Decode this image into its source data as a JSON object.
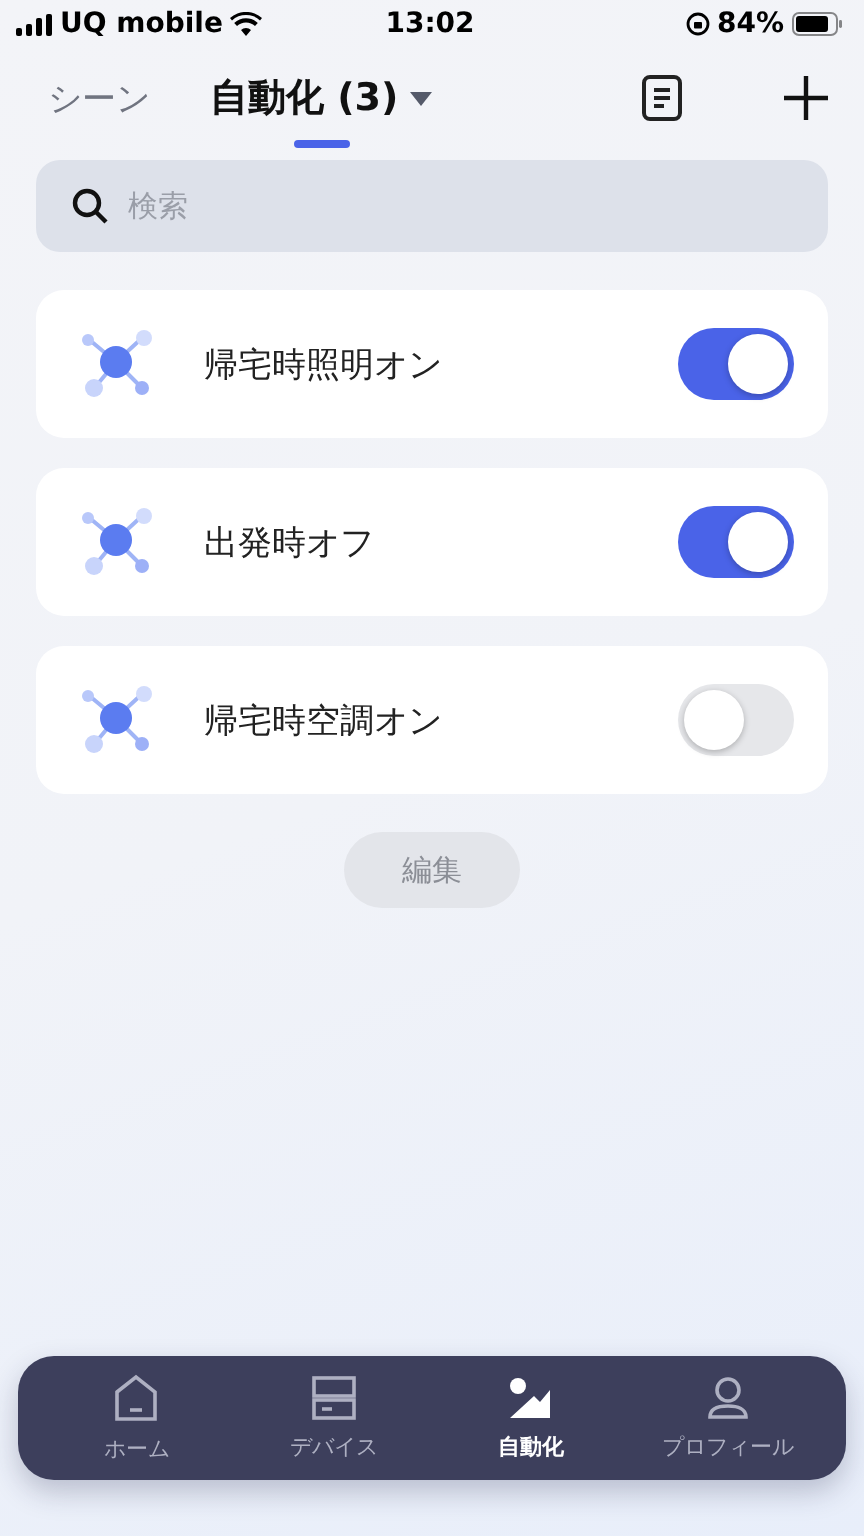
{
  "status_bar": {
    "carrier": "UQ mobile",
    "time": "13:02",
    "battery": "84%"
  },
  "header": {
    "tabs": [
      {
        "label": "シーン",
        "selected": false
      },
      {
        "label": "自動化 (3)",
        "selected": true
      }
    ]
  },
  "search": {
    "placeholder": "検索"
  },
  "automations": [
    {
      "name": "帰宅時照明オン",
      "on": true
    },
    {
      "name": "出発時オフ",
      "on": true
    },
    {
      "name": "帰宅時空調オン",
      "on": false
    }
  ],
  "edit_button": "編集",
  "nav": [
    {
      "kind": "home",
      "label": "ホーム",
      "selected": false
    },
    {
      "kind": "devices",
      "label": "デバイス",
      "selected": false
    },
    {
      "kind": "automation",
      "label": "自動化",
      "selected": true
    },
    {
      "kind": "profile",
      "label": "プロフィール",
      "selected": false
    }
  ]
}
